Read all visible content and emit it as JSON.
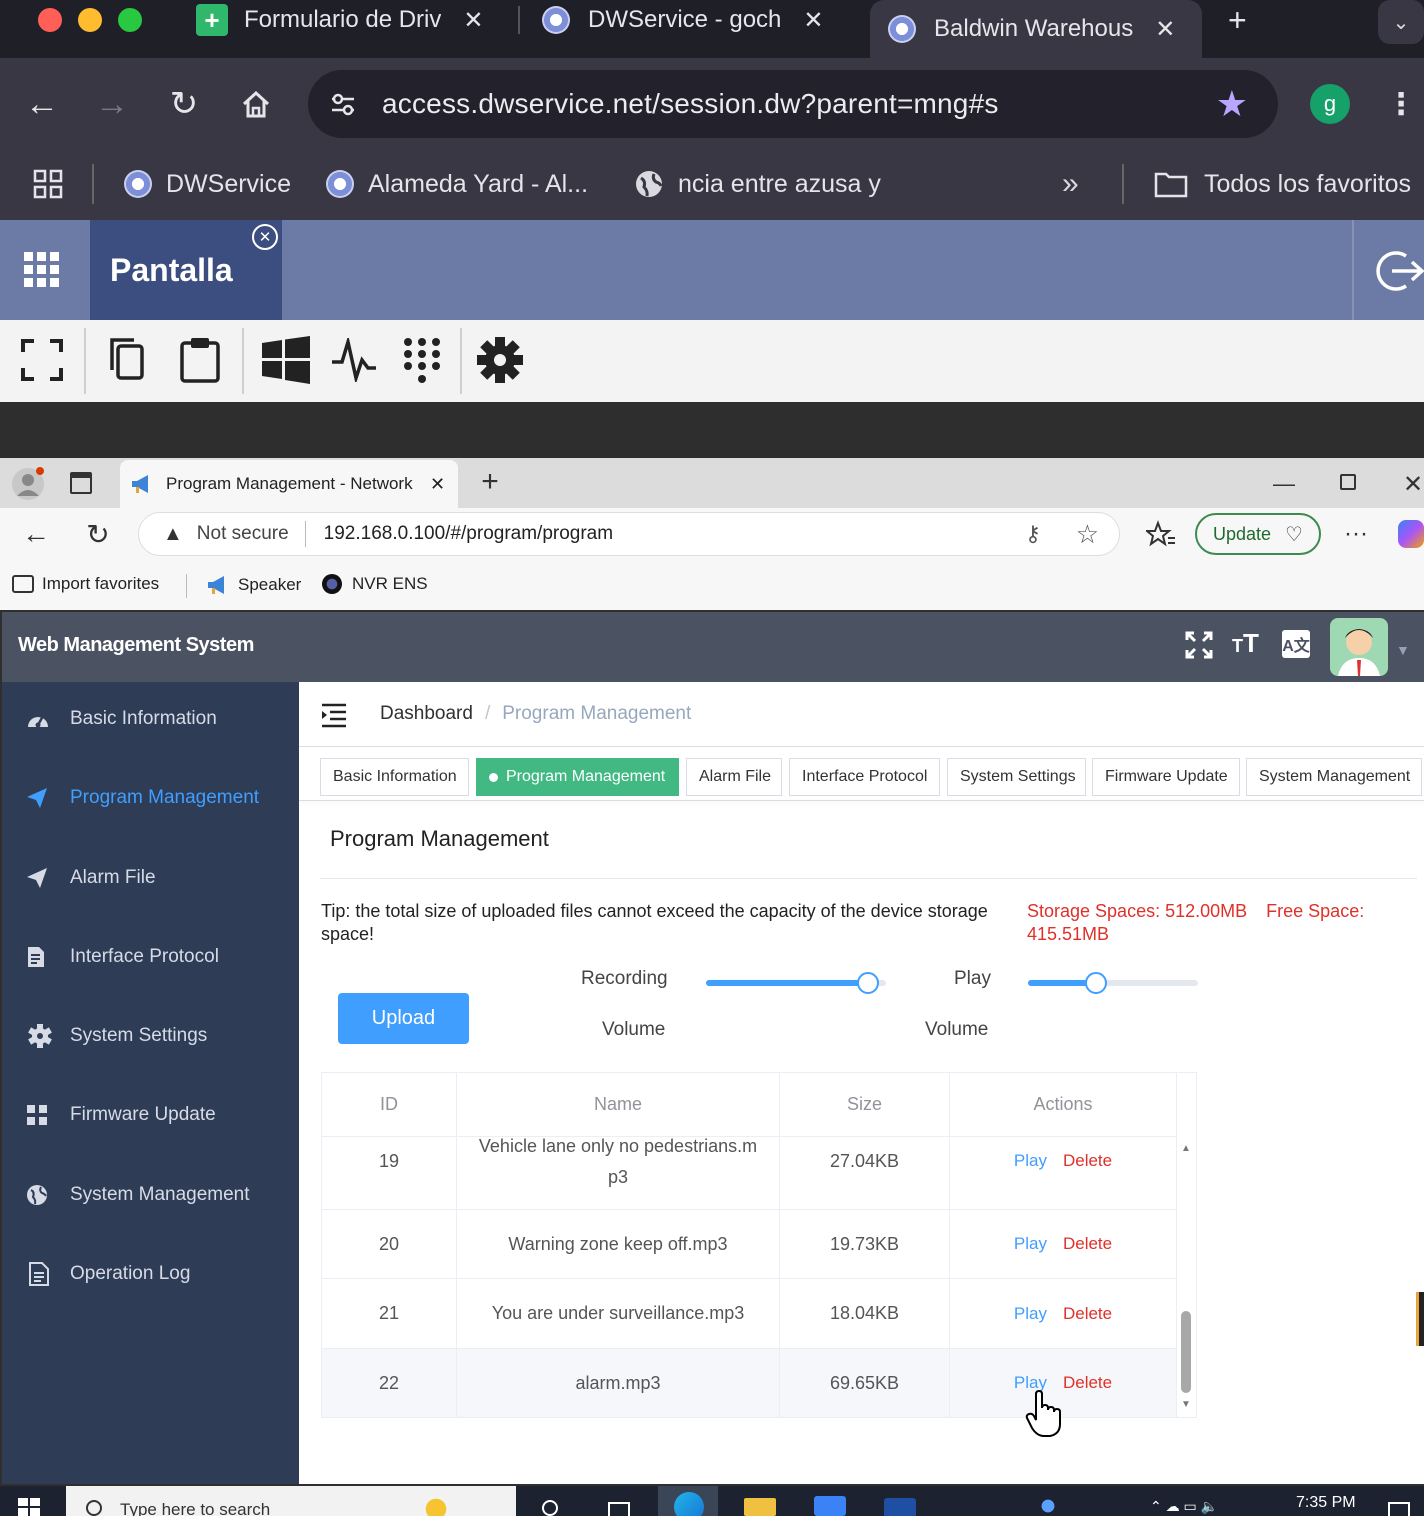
{
  "mac": {
    "tabs": [
      {
        "title": "Formulario de Driv",
        "close": "✕"
      },
      {
        "title": "DWService - goch",
        "close": "✕"
      },
      {
        "title": "Baldwin Warehous",
        "close": "✕"
      }
    ],
    "new_tab": "+",
    "url": "access.dwservice.net/session.dw?parent=mng#s",
    "profile_initial": "g",
    "bookmarks": [
      "DWService",
      "Alameda Yard - Al...",
      "ncia entre azusa y"
    ],
    "more_bookmarks": "»",
    "all_bookmarks": "Todos los favoritos"
  },
  "dw": {
    "tab_label": "Pantalla"
  },
  "edge": {
    "tab_title": "Program Management - Network",
    "not_secure": "Not secure",
    "url": "192.168.0.100/#/program/program",
    "update_label": "Update",
    "favorites": [
      "Import favorites",
      "Speaker",
      "NVR ENS"
    ]
  },
  "app": {
    "title": "Web Management System",
    "sidebar": [
      {
        "label": "Basic Information",
        "icon": "dashboard-icon"
      },
      {
        "label": "Program Management",
        "icon": "send-icon",
        "active": true
      },
      {
        "label": "Alarm File",
        "icon": "send-icon"
      },
      {
        "label": "Interface Protocol",
        "icon": "document-icon"
      },
      {
        "label": "System Settings",
        "icon": "gear-icon"
      },
      {
        "label": "Firmware Update",
        "icon": "grid-icon"
      },
      {
        "label": "System Management",
        "icon": "globe-icon"
      },
      {
        "label": "Operation Log",
        "icon": "log-icon"
      }
    ],
    "breadcrumb": {
      "home": "Dashboard",
      "sep": "/",
      "current": "Program Management"
    },
    "tags": [
      {
        "label": "Basic Information"
      },
      {
        "label": "Program Management",
        "active": true
      },
      {
        "label": "Alarm File"
      },
      {
        "label": "Interface Protocol"
      },
      {
        "label": "System Settings"
      },
      {
        "label": "Firmware Update"
      },
      {
        "label": "System Management"
      }
    ],
    "card_title": "Program Management",
    "tip": "Tip: the total size of uploaded files cannot exceed the capacity of the device storage space!",
    "storage_label": "Storage Spaces: 512.00MB",
    "free_label": "Free Space:",
    "free_value": "415.51MB",
    "upload_label": "Upload",
    "recording_label": "Recording",
    "recording_volume_label": "Volume",
    "recording_volume": 0.9,
    "play_label": "Play",
    "play_volume_label": "Volume",
    "play_volume": 0.4,
    "columns": [
      "ID",
      "Name",
      "Size",
      "Actions"
    ],
    "rows": [
      {
        "id": "19",
        "name": "Vehicle lane only no pedestrians.m",
        "name2": "p3",
        "size": "27.04KB",
        "play": "Play",
        "delete": "Delete"
      },
      {
        "id": "20",
        "name": "Warning zone keep off.mp3",
        "size": "19.73KB",
        "play": "Play",
        "delete": "Delete"
      },
      {
        "id": "21",
        "name": "You are under surveillance.mp3",
        "size": "18.04KB",
        "play": "Play",
        "delete": "Delete"
      },
      {
        "id": "22",
        "name": "alarm.mp3",
        "size": "69.65KB",
        "play": "Play",
        "delete": "Delete"
      }
    ]
  },
  "taskbar": {
    "search_placeholder": "Type here to search",
    "time": "7:35 PM"
  },
  "colors": {
    "accent": "#409eff",
    "active_tag": "#42b983",
    "danger": "#e0302a",
    "sidebar": "#2f3c55",
    "header": "#4b5262"
  }
}
